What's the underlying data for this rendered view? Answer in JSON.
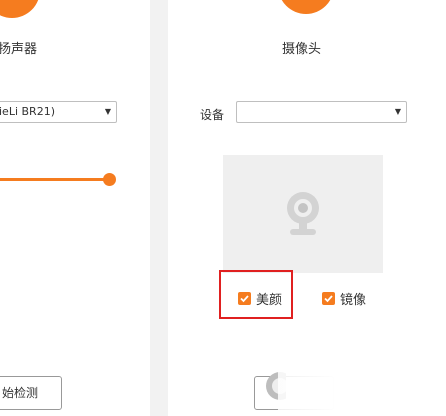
{
  "speaker": {
    "title": "扬声器",
    "device_value": "ieLi BR21)",
    "volume_fraction": 0.95,
    "button_label": "始检测"
  },
  "camera": {
    "title": "摄像头",
    "device_label": "设备",
    "device_value": "",
    "options": [
      {
        "label": "美颜",
        "checked": true
      },
      {
        "label": "镜像",
        "checked": true
      }
    ]
  },
  "colors": {
    "accent": "#f57c1f",
    "highlight": "#e02020",
    "preview_bg": "#efefef"
  }
}
